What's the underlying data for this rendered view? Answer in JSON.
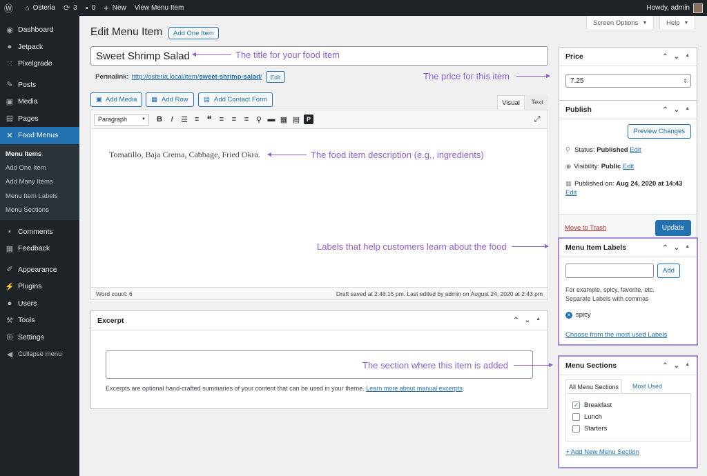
{
  "adminbar": {
    "site_name": "Osteria",
    "updates_count": "3",
    "comments_count": "0",
    "new_label": "New",
    "view_label": "View Menu Item",
    "howdy": "Howdy, admin"
  },
  "sidebar": {
    "items_top": [
      {
        "label": "Dashboard",
        "icon": "dashboard-icon"
      },
      {
        "label": "Jetpack",
        "icon": "jetpack-icon"
      },
      {
        "label": "Pixelgrade",
        "icon": "pixelgrade-icon"
      }
    ],
    "items_mid": [
      {
        "label": "Posts",
        "icon": "pin-icon"
      },
      {
        "label": "Media",
        "icon": "media-icon"
      },
      {
        "label": "Pages",
        "icon": "page-icon"
      }
    ],
    "active": {
      "label": "Food Menus",
      "icon": "food-menus-icon"
    },
    "submenu": [
      "Menu Items",
      "Add One Item",
      "Add Many Items",
      "Menu Item Labels",
      "Menu Sections"
    ],
    "items_bottom": [
      {
        "label": "Comments",
        "icon": "comment-icon"
      },
      {
        "label": "Feedback",
        "icon": "feedback-icon"
      }
    ],
    "items_tools": [
      {
        "label": "Appearance",
        "icon": "brush-icon"
      },
      {
        "label": "Plugins",
        "icon": "plugin-icon"
      },
      {
        "label": "Users",
        "icon": "users-icon"
      },
      {
        "label": "Tools",
        "icon": "wrench-icon"
      },
      {
        "label": "Settings",
        "icon": "settings-icon"
      },
      {
        "label": "Collapse menu",
        "icon": "collapse-icon"
      }
    ]
  },
  "header": {
    "title": "Edit Menu Item",
    "add_one_item": "Add One Item",
    "screen_options": "Screen Options",
    "help": "Help"
  },
  "editor": {
    "post_title": "Sweet Shrimp Salad",
    "permalink_label": "Permalink:",
    "permalink_base": "http://osteria.local/item/",
    "permalink_slug": "sweet-shrimp-salad",
    "permalink_end": "/",
    "edit_label": "Edit",
    "add_media": "Add Media",
    "add_row": "Add Row",
    "add_contact_form": "Add Contact Form",
    "tab_visual": "Visual",
    "tab_text": "Text",
    "format_select": "Paragraph",
    "content": "Tomatillo, Baja Crema, Cabbage, Fried Okra.",
    "word_count": "Word count: 6",
    "draft_saved": "Draft saved at 2:46:15 pm. Last edited by admin on August 24, 2020 at 2:43 pm"
  },
  "excerpt": {
    "title": "Excerpt",
    "value": "",
    "help_text": "Excerpts are optional hand-crafted summaries of your content that can be used in your theme.",
    "help_link": "Learn more about manual excerpts",
    "help_end": "."
  },
  "price": {
    "title": "Price",
    "value": "7.25"
  },
  "publish": {
    "title": "Publish",
    "preview": "Preview Changes",
    "status_label": "Status:",
    "status_value": "Published",
    "visibility_label": "Visibility:",
    "visibility_value": "Public",
    "published_label": "Published on:",
    "published_value": "Aug 24, 2020 at 14:43",
    "edit": "Edit",
    "trash": "Move to Trash",
    "update": "Update"
  },
  "labels_box": {
    "title": "Menu Item Labels",
    "input_value": "",
    "add": "Add",
    "help1": "For example, spicy, favorite, etc.",
    "help2": "Separate Labels with commas",
    "tag": "spicy",
    "choose": "Choose from the most used Labels"
  },
  "sections_box": {
    "title": "Menu Sections",
    "tab_all": "All Menu Sections",
    "tab_most": "Most Used",
    "items": [
      {
        "label": "Breakfast",
        "checked": true
      },
      {
        "label": "Lunch",
        "checked": false
      },
      {
        "label": "Starters",
        "checked": false
      }
    ],
    "add_new": "+ Add New Menu Section"
  },
  "annotations": {
    "title": "The title for your food item",
    "price": "The price for this item",
    "description": "The food item description (e.g., ingredients)",
    "labels": "Labels that help customers learn about the food",
    "sections": "The section where this item is added"
  },
  "colors": {
    "accent": "#2271b1",
    "annotation": "#8c5ed3",
    "sidebar": "#1d2327"
  }
}
